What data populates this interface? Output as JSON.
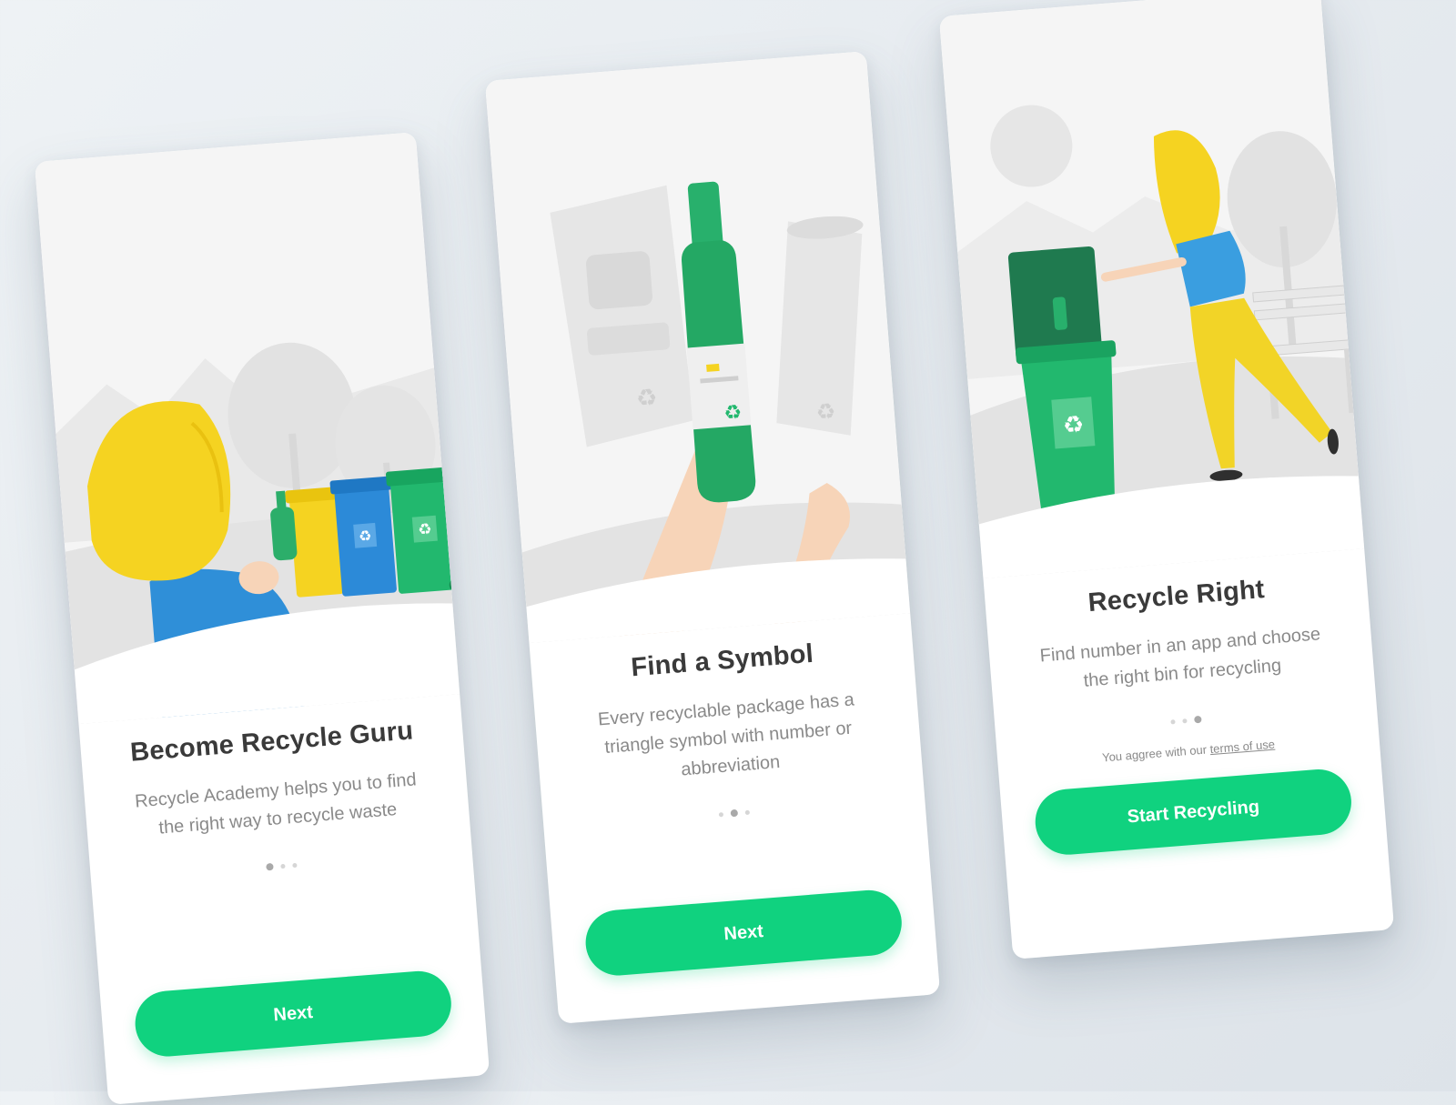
{
  "screens": [
    {
      "title": "Become Recycle Guru",
      "description": "Recycle Academy helps you to find the right way to recycle waste",
      "button_label": "Next",
      "pager": {
        "current": 1,
        "total": 3
      }
    },
    {
      "title": "Find a Symbol",
      "description": "Every recyclable package has a triangle symbol with number or abbreviation",
      "button_label": "Next",
      "pager": {
        "current": 2,
        "total": 3
      }
    },
    {
      "title": "Recycle Right",
      "description": "Find number in an app and choose the right bin for recycling",
      "terms_prefix": "You aggree with our",
      "terms_link": "terms of use",
      "button_label": "Start Recycling",
      "pager": {
        "current": 3,
        "total": 3
      }
    }
  ],
  "colors": {
    "accent": "#10d27f",
    "bin_yellow": "#f5d321",
    "bin_blue": "#2c8ad8",
    "bin_green": "#22b86e",
    "hair": "#f5d321",
    "shirt": "#3a9ee0",
    "background": "#e9edf1"
  },
  "icons": [
    "recycle-icon",
    "bottle-icon",
    "can-icon",
    "chips-bag-icon",
    "bench-icon",
    "tree-icon",
    "sun-icon"
  ]
}
